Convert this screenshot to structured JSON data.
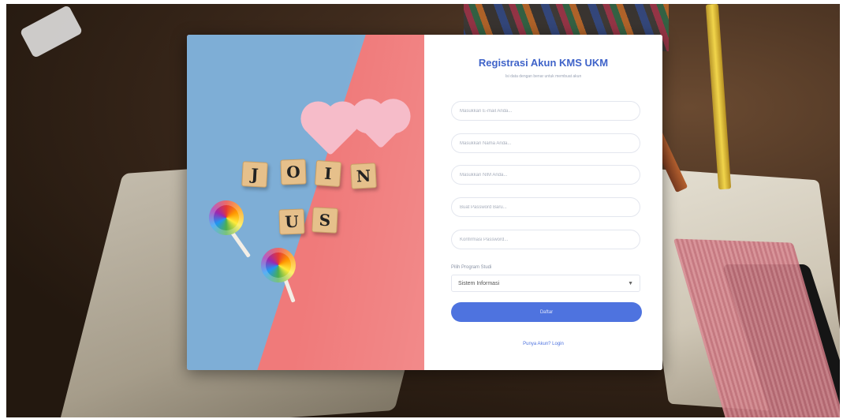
{
  "form": {
    "title": "Registrasi Akun KMS UKM",
    "subtitle": "Isi data dengan benar untuk membuat akun",
    "fields": [
      {
        "placeholder": "Masukkan E-mail Anda..."
      },
      {
        "placeholder": "Masukkan Nama Anda..."
      },
      {
        "placeholder": "Masukkan NIM Anda..."
      },
      {
        "placeholder": "Buat Password Baru..."
      },
      {
        "placeholder": "Konfirmasi Password..."
      }
    ],
    "program_label": "Pilih Program Studi",
    "program_selected": "Sistem Informasi",
    "register_label": "Daftar",
    "login_link": "Punya Akun? Login"
  },
  "hero": {
    "tiles_row1": [
      "J",
      "O",
      "I",
      "N"
    ],
    "tiles_row2": [
      "U",
      "S"
    ]
  },
  "colors": {
    "accent": "#4e73df",
    "title": "#3f63c9",
    "hero_blue": "#7eaed6",
    "hero_pink": "#f07a7a"
  }
}
